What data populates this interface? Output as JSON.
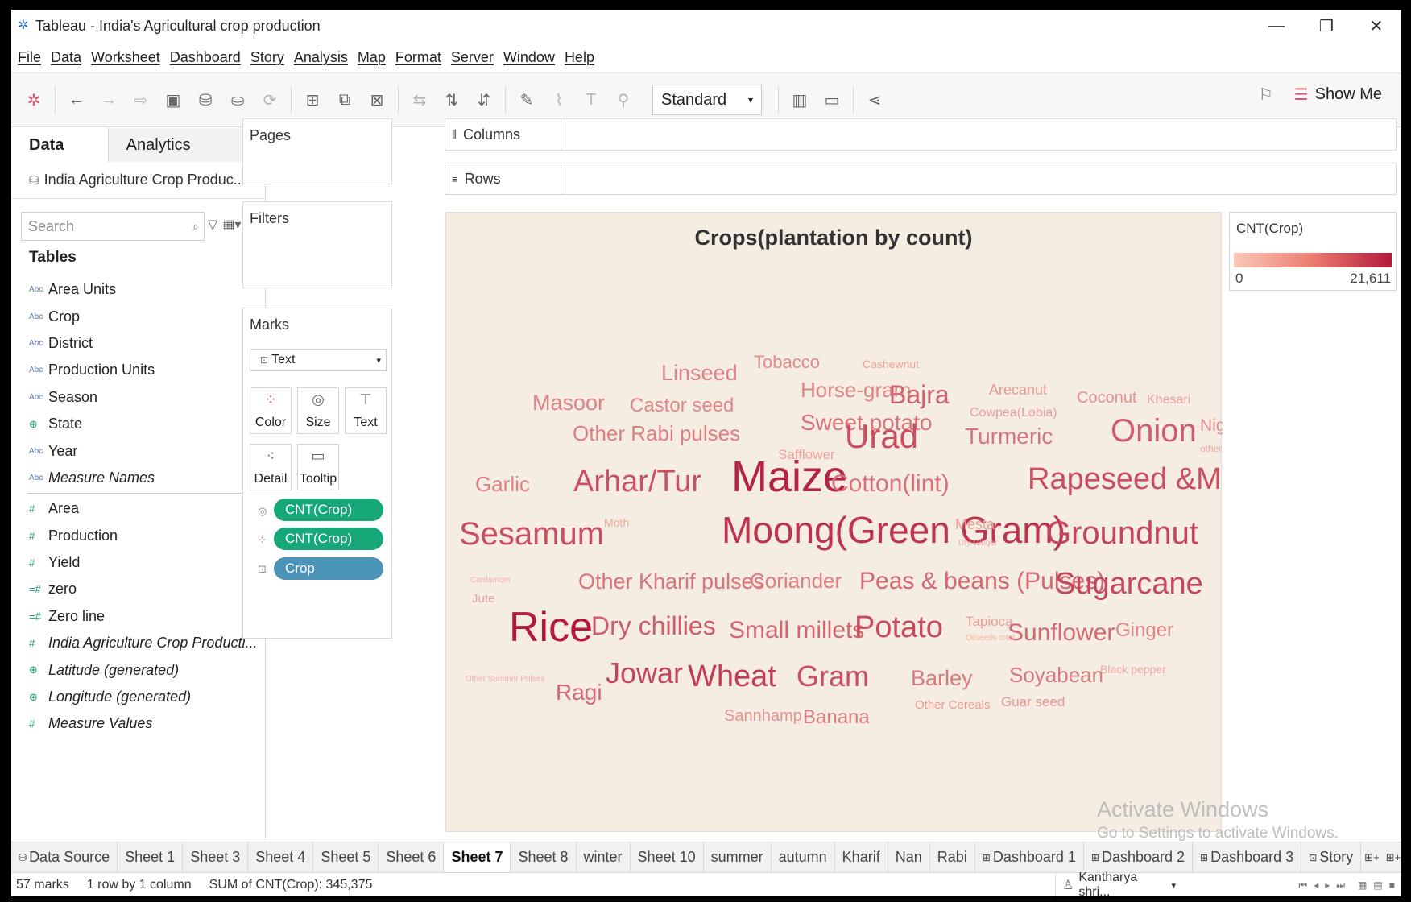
{
  "window": {
    "title": "Tableau - India's Agricultural crop production"
  },
  "menu": [
    "File",
    "Data",
    "Worksheet",
    "Dashboard",
    "Story",
    "Analysis",
    "Map",
    "Format",
    "Server",
    "Window",
    "Help"
  ],
  "toolbar": {
    "fit": "Standard",
    "show_me": "Show Me"
  },
  "left_pane": {
    "tabs": {
      "data": "Data",
      "analytics": "Analytics"
    },
    "datasource": "India Agriculture Crop Produc...",
    "search_placeholder": "Search",
    "tables_heading": "Tables",
    "dimensions": [
      {
        "type": "Abc",
        "name": "Area Units"
      },
      {
        "type": "Abc",
        "name": "Crop"
      },
      {
        "type": "Abc",
        "name": "District"
      },
      {
        "type": "Abc",
        "name": "Production Units"
      },
      {
        "type": "Abc",
        "name": "Season"
      },
      {
        "type": "globe",
        "name": "State"
      },
      {
        "type": "Abc",
        "name": "Year"
      },
      {
        "type": "Abc",
        "name": "Measure Names"
      }
    ],
    "measures": [
      {
        "type": "#",
        "name": "Area"
      },
      {
        "type": "#",
        "name": "Production"
      },
      {
        "type": "#",
        "name": "Yield"
      },
      {
        "type": "=#",
        "name": "zero"
      },
      {
        "type": "=#",
        "name": "Zero line"
      },
      {
        "type": "#",
        "name": "India Agriculture Crop Producti..."
      },
      {
        "type": "globe",
        "name": "Latitude (generated)"
      },
      {
        "type": "globe",
        "name": "Longitude (generated)"
      },
      {
        "type": "#",
        "name": "Measure Values"
      }
    ]
  },
  "shelves": {
    "pages": "Pages",
    "filters": "Filters",
    "columns": "Columns",
    "rows": "Rows"
  },
  "marks": {
    "title": "Marks",
    "type": "Text",
    "buttons": {
      "color": "Color",
      "size": "Size",
      "text": "Text",
      "detail": "Detail",
      "tooltip": "Tooltip"
    },
    "pills": [
      {
        "label": "CNT(Crop)",
        "color": "#17a87a"
      },
      {
        "label": "CNT(Crop)",
        "color": "#17a87a"
      },
      {
        "label": "Crop",
        "color": "#4c93b8"
      }
    ]
  },
  "viz": {
    "title": "Crops(plantation by count)"
  },
  "legend": {
    "title": "CNT(Crop)",
    "min": "0",
    "max": "21,611",
    "color_low": "#fbc8b6",
    "color_high": "#b21a3b"
  },
  "chart_data": {
    "type": "word-cloud",
    "title": "Crops(plantation by count)",
    "measure": "CNT(Crop)",
    "color_range": [
      0,
      21611
    ],
    "words": [
      {
        "text": "Tobacco",
        "value": 0.35
      },
      {
        "text": "Cashewnut",
        "value": 0.2
      },
      {
        "text": "Linseed",
        "value": 0.4
      },
      {
        "text": "Horse-gram",
        "value": 0.38
      },
      {
        "text": "Bajra",
        "value": 0.58
      },
      {
        "text": "Arecanut",
        "value": 0.27
      },
      {
        "text": "Coconut",
        "value": 0.31
      },
      {
        "text": "Khesari",
        "value": 0.22
      },
      {
        "text": "Masoor",
        "value": 0.4
      },
      {
        "text": "Castor seed",
        "value": 0.37
      },
      {
        "text": "Cowpea(Lobia)",
        "value": 0.24
      },
      {
        "text": "Sweet potato",
        "value": 0.48
      },
      {
        "text": "Niger seed",
        "value": 0.33
      },
      {
        "text": "Other Rabi pulses",
        "value": 0.42
      },
      {
        "text": "Urad",
        "value": 0.7
      },
      {
        "text": "Turmeric",
        "value": 0.48
      },
      {
        "text": "Onion",
        "value": 0.62
      },
      {
        "text": "Safflower",
        "value": 0.21
      },
      {
        "text": "other oilseeds",
        "value": 0.17
      },
      {
        "text": "Garlic",
        "value": 0.4
      },
      {
        "text": "Arhar/Tur",
        "value": 0.68
      },
      {
        "text": "Maize",
        "value": 0.95
      },
      {
        "text": "Cotton(lint)",
        "value": 0.5
      },
      {
        "text": "Rapeseed &Mustard",
        "value": 0.7
      },
      {
        "text": "Sesamum",
        "value": 0.7
      },
      {
        "text": "Moth",
        "value": 0.18
      },
      {
        "text": "Moong(Green Gram)",
        "value": 0.85
      },
      {
        "text": "Mesta",
        "value": 0.24
      },
      {
        "text": "Groundnut",
        "value": 0.76
      },
      {
        "text": "Dry Ginger",
        "value": 0.15
      },
      {
        "text": "Cardamom",
        "value": 0.13
      },
      {
        "text": "Other Kharif pulses",
        "value": 0.48
      },
      {
        "text": "Coriander",
        "value": 0.42
      },
      {
        "text": "Peas & beans (Pulses)",
        "value": 0.55
      },
      {
        "text": "Sugarcane",
        "value": 0.74
      },
      {
        "text": "Jute",
        "value": 0.22
      },
      {
        "text": "Rice",
        "value": 1.0
      },
      {
        "text": "Dry chillies",
        "value": 0.62
      },
      {
        "text": "Small millets",
        "value": 0.56
      },
      {
        "text": "Potato",
        "value": 0.72
      },
      {
        "text": "Tapioca",
        "value": 0.25
      },
      {
        "text": "Sunflower",
        "value": 0.55
      },
      {
        "text": "Ginger",
        "value": 0.38
      },
      {
        "text": "Oilseeds total",
        "value": 0.12
      },
      {
        "text": "Other Summer Pulses",
        "value": 0.12
      },
      {
        "text": "Jowar",
        "value": 0.75
      },
      {
        "text": "Wheat",
        "value": 0.8
      },
      {
        "text": "Gram",
        "value": 0.7
      },
      {
        "text": "Barley",
        "value": 0.45
      },
      {
        "text": "Soyabean",
        "value": 0.46
      },
      {
        "text": "Black pepper",
        "value": 0.19
      },
      {
        "text": "Ragi",
        "value": 0.55
      },
      {
        "text": "Other Cereals",
        "value": 0.25
      },
      {
        "text": "Guar seed",
        "value": 0.28
      },
      {
        "text": "Sannhamp",
        "value": 0.3
      },
      {
        "text": "Banana",
        "value": 0.42
      }
    ]
  },
  "tabs": [
    "Data Source",
    "Sheet 1",
    "Sheet 3",
    "Sheet 4",
    "Sheet 5",
    "Sheet 6",
    "Sheet 7",
    "Sheet 8",
    "winter",
    "Sheet 10",
    "summer",
    "autumn",
    "Kharif",
    "Nan",
    "Rabi",
    "Dashboard 1",
    "Dashboard 2",
    "Dashboard 3",
    "Story"
  ],
  "active_tab": "Sheet 7",
  "status": {
    "marks": "57 marks",
    "layout": "1 row by 1 column",
    "sum": "SUM of CNT(Crop): 345,375",
    "user": "Kantharya shri..."
  },
  "watermark": {
    "line1": "Activate Windows",
    "line2": "Go to Settings to activate Windows."
  }
}
